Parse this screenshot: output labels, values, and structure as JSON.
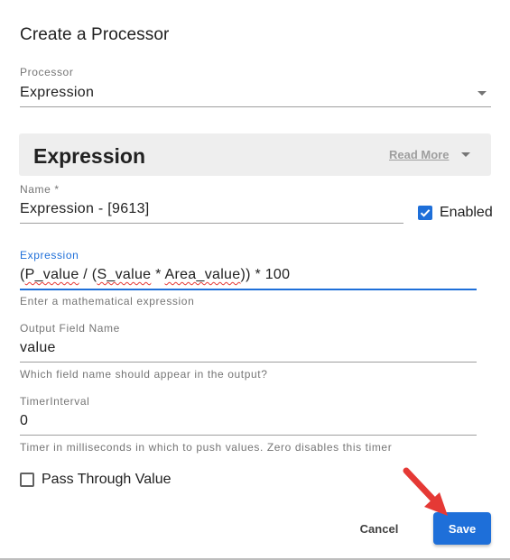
{
  "dialog": {
    "title": "Create a Processor"
  },
  "processor": {
    "label": "Processor",
    "value": "Expression"
  },
  "info_panel": {
    "title": "Expression",
    "read_more": "Read More"
  },
  "name_field": {
    "label": "Name *",
    "value": "Expression  - [9613]"
  },
  "enabled": {
    "label": "Enabled",
    "checked": true
  },
  "expression_field": {
    "label": "Expression",
    "value_parts": [
      "(",
      "P_value",
      " / (",
      "S_value",
      " * ",
      "Area_value",
      ")) * 100"
    ],
    "hint": "Enter a mathematical expression"
  },
  "output_field": {
    "label": "Output Field Name",
    "value": "value",
    "hint": "Which field name should appear in the output?"
  },
  "timer_field": {
    "label": "TimerInterval",
    "value": "0",
    "hint": "Timer in milliseconds in which to push values. Zero disables this timer"
  },
  "pass_through": {
    "label": "Pass Through Value",
    "checked": false
  },
  "actions": {
    "cancel": "Cancel",
    "save": "Save"
  },
  "colors": {
    "accent": "#1e6fd9",
    "annotation_arrow": "#e53935"
  }
}
